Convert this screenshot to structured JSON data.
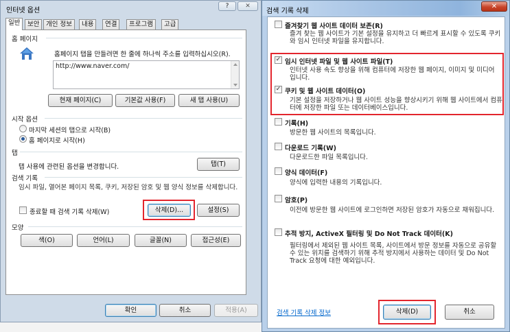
{
  "left": {
    "title": "인터넷 옵션",
    "help_glyph": "?",
    "close_glyph": "✕",
    "tabs": [
      "일반",
      "보안",
      "개인 정보",
      "내용",
      "연결",
      "프로그램",
      "고급"
    ],
    "home": {
      "group": "홈 페이지",
      "description": "홈페이지 탭을 만들려면 한 줄에 하나씩 주소를 입력하십시오(R).",
      "url": "http://www.naver.com/",
      "btn_current": "현재 페이지(C)",
      "btn_default": "기본값 사용(F)",
      "btn_newtab": "새 탭 사용(U)"
    },
    "startup": {
      "group": "시작 옵션",
      "option_last": "마지막 세션의 탭으로 시작(B)",
      "option_home": "홈 페이지로 시작(H)"
    },
    "tabs_group": {
      "group": "탭",
      "description": "탭 사용에 관련된 옵션을 변경합니다.",
      "btn": "탭(T)"
    },
    "history": {
      "group": "검색 기록",
      "description": "임시 파일, 열어본 페이지 목록, 쿠키, 저장된 암호 및 웹 양식 정보를 삭제합니다.",
      "checkbox_label": "종료할 때 검색 기록 삭제(W)",
      "btn_delete": "삭제(D)...",
      "btn_settings": "설정(S)"
    },
    "appearance": {
      "group": "모양",
      "btn_colors": "색(O)",
      "btn_languages": "언어(L)",
      "btn_fonts": "글꼴(N)",
      "btn_accessibility": "접근성(E)"
    },
    "footer": {
      "ok": "확인",
      "cancel": "취소",
      "apply": "적용(A)"
    }
  },
  "right": {
    "title": "검색 기록 삭제",
    "close_glyph": "✕",
    "items": [
      {
        "title": "즐겨찾기 웹 사이트 데이터 보존(R)",
        "checked": false,
        "description": "즐겨 찾는 웹 사이트가 기본 설정을 유지하고 더 빠르게 표시할 수 있도록 쿠키와 임시 인터넷 파일을 유지합니다."
      },
      {
        "title": "임시 인터넷 파일 및 웹 사이트 파일(T)",
        "checked": true,
        "description": "인터넷 사용 속도 향상을 위해 컴퓨터에 저장한 웹 페이지, 이미지 및 미디어입니다."
      },
      {
        "title": "쿠키 및 웹 사이트 데이터(O)",
        "checked": true,
        "description": "기본 설정을 저장하거나 웹 사이트 성능을 향상시키기 위해 웹 사이트에서 컴퓨터에 저장한 파일 또는 데이터베이스입니다."
      },
      {
        "title": "기록(H)",
        "checked": false,
        "description": "방문한 웹 사이트의 목록입니다."
      },
      {
        "title": "다운로드 기록(W)",
        "checked": false,
        "description": "다운로드한 파일 목록입니다."
      },
      {
        "title": "양식 데이터(F)",
        "checked": false,
        "description": "양식에 입력한 내용의 기록입니다."
      },
      {
        "title": "암호(P)",
        "checked": false,
        "description": "이전에 방문한 웹 사이트에 로그인하면 저장된 암호가 자동으로 채워집니다."
      },
      {
        "title": "추적 방지, ActiveX 필터링 및 Do Not Track 데이터(K)",
        "checked": false,
        "description": "필터링에서 제외된 웹 사이트 목록, 사이트에서 방문 정보를 자동으로 공유할 수 있는 위치를 검색하기 위해 추적 방지에서 사용하는 데이터 및 Do Not Track 요청에 대한 예외입니다."
      }
    ],
    "link": "검색 기록 삭제 정보",
    "btn_delete": "삭제(D)",
    "btn_cancel": "취소"
  }
}
